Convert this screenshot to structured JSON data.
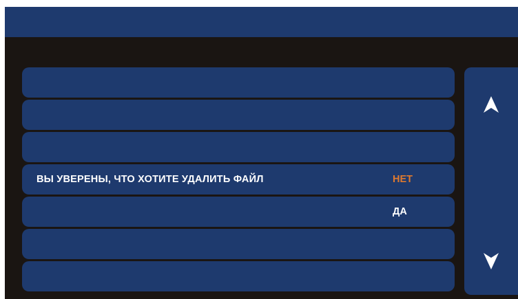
{
  "dialog": {
    "message": "ВЫ УВЕРЕНЫ, ЧТО ХОТИТЕ УДАЛИТЬ ФАЙЛ",
    "option_no": "НЕТ",
    "option_yes": "ДА"
  },
  "scroll": {
    "up_icon": "arrow-up-icon",
    "down_icon": "arrow-down-icon"
  },
  "colors": {
    "panel": "#1e3a6e",
    "background": "#1a1512",
    "accent_no": "#e07a2e",
    "text": "#ffffff"
  }
}
